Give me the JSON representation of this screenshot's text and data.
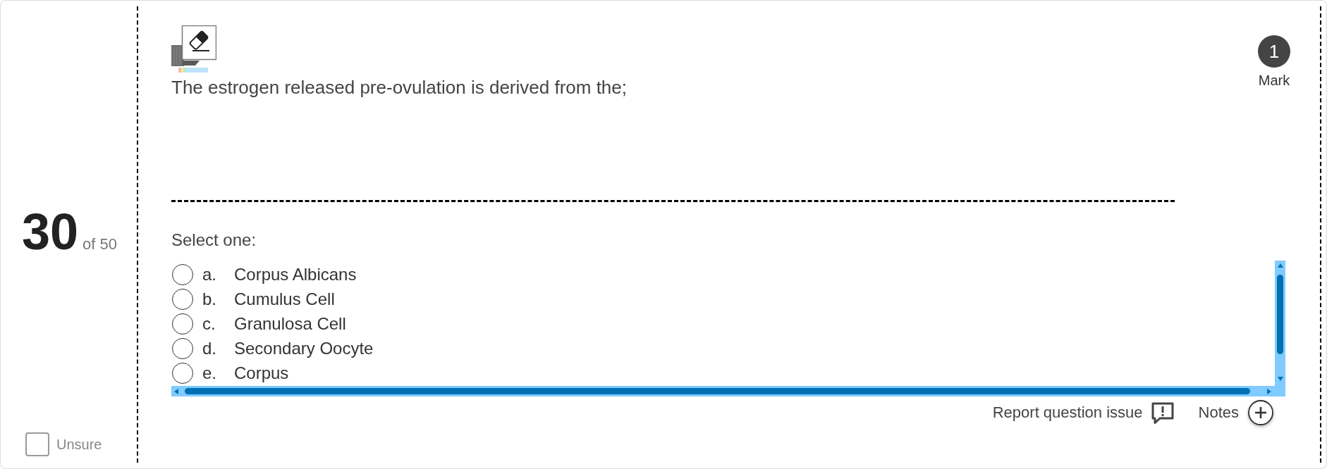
{
  "question_number": "30",
  "question_total": "of 50",
  "unsure": {
    "label": "Unsure",
    "checked": false
  },
  "question_text": "The estrogen released pre-ovulation is derived from the;",
  "mark": {
    "count": "1",
    "label": "Mark"
  },
  "prompt": "Select one:",
  "options": [
    {
      "letter": "a.",
      "text": "Corpus Albicans",
      "selected": false
    },
    {
      "letter": "b.",
      "text": "Cumulus Cell",
      "selected": false
    },
    {
      "letter": "c.",
      "text": "Granulosa Cell",
      "selected": false
    },
    {
      "letter": "d.",
      "text": "Secondary Oocyte",
      "selected": false
    },
    {
      "letter": "e.",
      "text": "Corpus",
      "selected": false
    }
  ],
  "footer": {
    "report_label": "Report question issue",
    "notes_label": "Notes"
  }
}
